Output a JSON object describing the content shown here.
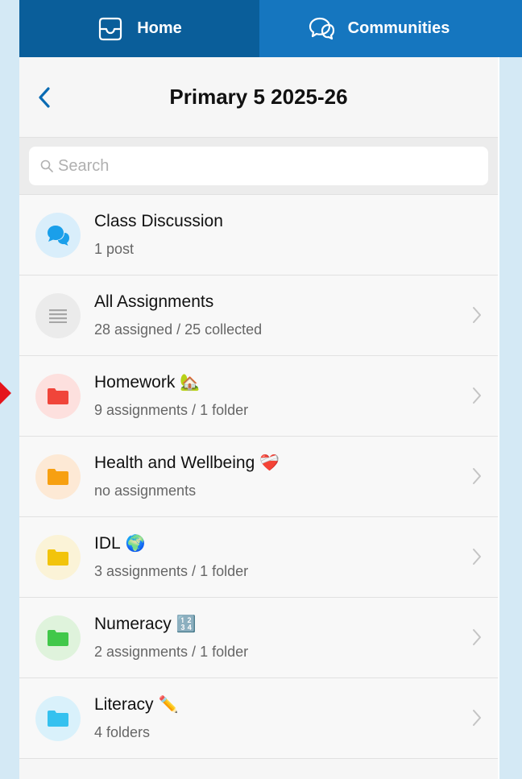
{
  "tabs": {
    "home_label": "Home",
    "communities_label": "Communities"
  },
  "nav": {
    "title": "Primary 5 2025-26"
  },
  "search": {
    "placeholder": "Search"
  },
  "rows": [
    {
      "title": "Class Discussion",
      "emoji": "",
      "subtitle": "1 post",
      "color": "#1a9fea",
      "bg": "#d9eefb"
    },
    {
      "title": "All Assignments",
      "emoji": "",
      "subtitle": "28 assigned / 25 collected",
      "color": "#9a9a9a",
      "bg": "#ebebeb"
    },
    {
      "title": "Homework",
      "emoji": "🏡",
      "subtitle": "9 assignments / 1 folder",
      "color": "#f0453a",
      "bg": "#fde0de"
    },
    {
      "title": "Health and Wellbeing",
      "emoji": "❤️‍🩹",
      "subtitle": "no assignments",
      "color": "#f7a011",
      "bg": "#fde9d5"
    },
    {
      "title": "IDL",
      "emoji": "🌍",
      "subtitle": "3 assignments / 1 folder",
      "color": "#f2c40c",
      "bg": "#fbf3d7"
    },
    {
      "title": "Numeracy",
      "emoji": "🔢",
      "subtitle": "2 assignments / 1 folder",
      "color": "#41c84a",
      "bg": "#dff3dc"
    },
    {
      "title": "Literacy",
      "emoji": "✏️",
      "subtitle": "4 folders",
      "color": "#35c1ef",
      "bg": "#d9f1fb"
    }
  ],
  "colors": {
    "home_tab": "#0a5e9a",
    "communities_tab": "#1576bf",
    "accent": "#0a6bb3",
    "pointer": "#e5141b"
  }
}
